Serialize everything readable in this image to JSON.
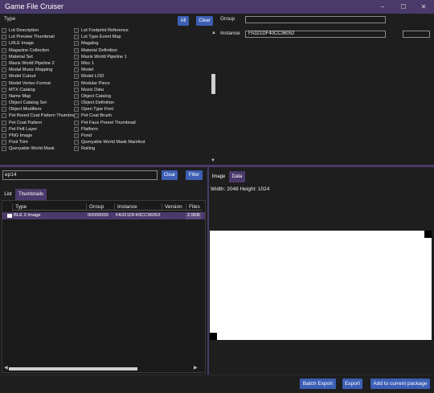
{
  "window": {
    "title": "Game File Cruiser",
    "controls": {
      "minimize": "−",
      "maximize": "☐",
      "close": "✕"
    }
  },
  "type_panel": {
    "label": "Type",
    "all_button": "All",
    "clear_button": "Clear",
    "column1": [
      "Lot Description",
      "Lot Preview Thumbnail",
      "LRLE Image",
      "Magazine Collection",
      "Material Set",
      "Maxis World Pipeline 2",
      "Modal Music Mapping",
      "Model Cutout",
      "Model Vertex Format",
      "MTX Catalog",
      "Name Map",
      "Object Catalog Set",
      "Object Modifiers",
      "Pet Breed Coat Pattern Thumbnail",
      "Pet Coat Pattern",
      "Pet Pelt Layer",
      "PNG Image",
      "Pool Trim",
      "Queryable World Mask"
    ],
    "column2": [
      "Lot Footprint Reference",
      "Lot Type Event Map",
      "Magalog",
      "Material Definition",
      "Maxis World Pipeline 1",
      "Misc 1",
      "Model",
      "Model LOD",
      "Modular Piece",
      "Music Data",
      "Object Catalog",
      "Object Definition",
      "Open Type Font",
      "Pet Coat Brush",
      "Pet Face Preset Thumbnail",
      "Platform",
      "Pond",
      "Queryable World Mask Manifest",
      "Railing"
    ]
  },
  "filters": {
    "group_label": "Group",
    "group_value": "",
    "instance_label": "Instance",
    "instance_value": "FA321DF40CC36052",
    "extra_value": ""
  },
  "query": {
    "value": "ep14",
    "clear_button": "Clear",
    "filter_button": "Filter"
  },
  "left_tabs": {
    "list": "List",
    "thumbnails": "Thumbnails"
  },
  "grid": {
    "columns": [
      "Type",
      "Group",
      "Instance",
      "Version",
      "Files"
    ],
    "rows": [
      {
        "type": "BLE 2 Image",
        "group": "00000000",
        "instance": "FA321DF40CC36052",
        "version": "",
        "files": "2.5KB"
      }
    ]
  },
  "right_tabs": {
    "image": "Image",
    "data": "Data"
  },
  "preview": {
    "info": "Width: 2048 Height: 1024"
  },
  "actions": {
    "batch_export": "Batch Export",
    "export": "Export",
    "add_to_package": "Add to current package"
  },
  "colors": {
    "accent_purple": "#4a3a6a",
    "button_blue": "#3c5fb5",
    "background": "#1e1e1e"
  }
}
